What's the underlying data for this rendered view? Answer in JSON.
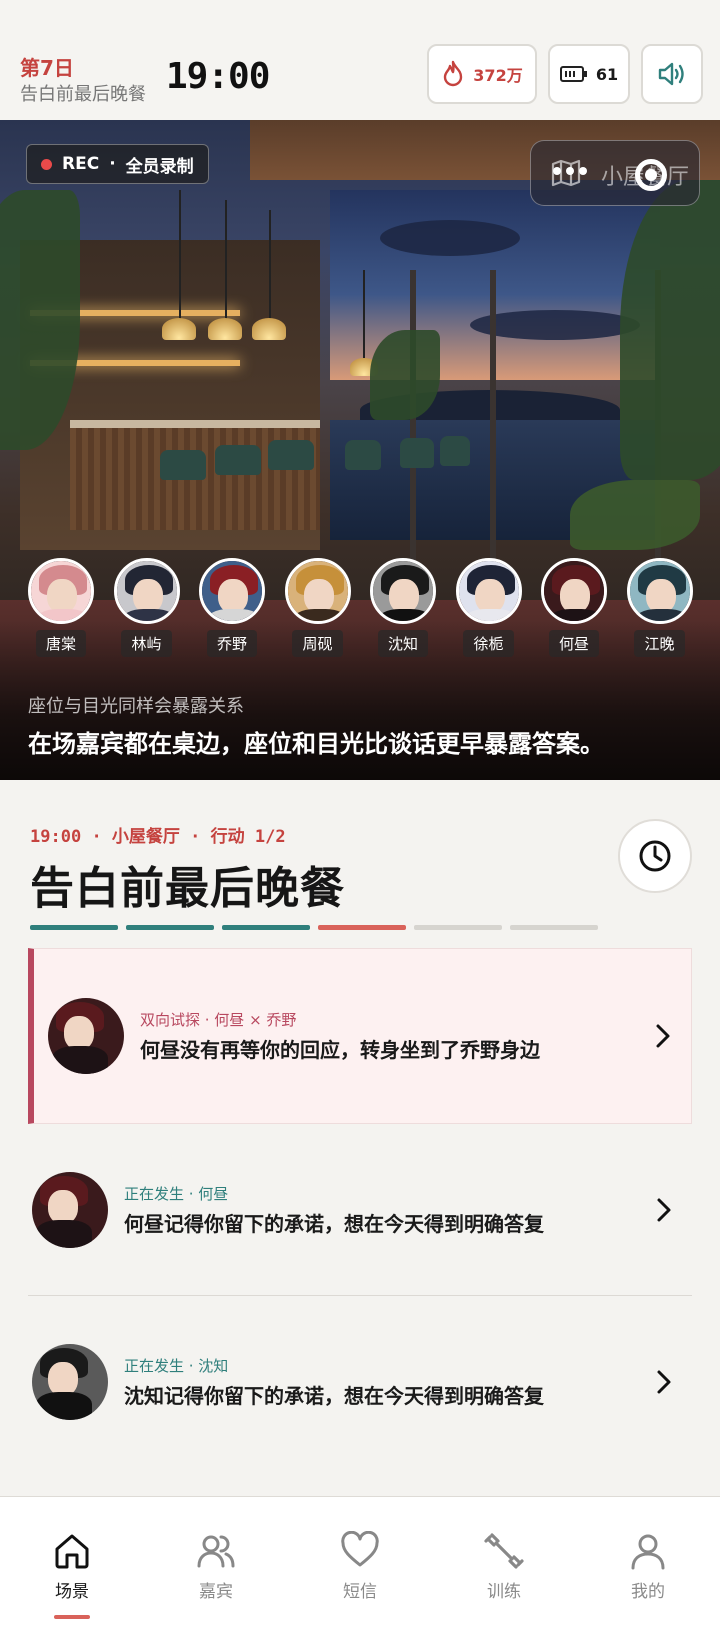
{
  "header": {
    "day": "第7日",
    "scene_name": "告白前最后晚餐",
    "time": "19:00",
    "heat": "372万",
    "battery": "61",
    "heat_icon": "flame-icon",
    "battery_icon": "battery-icon",
    "sound_icon": "speaker-icon"
  },
  "hero": {
    "rec_label": "REC",
    "rec_separator": "·",
    "rec_mode": "全员录制",
    "location_button": "小屋餐厅",
    "guests": [
      {
        "name": "唐棠",
        "hair": "#d48a8e",
        "body": "#f2c6c9",
        "bg": "#f6d6d6"
      },
      {
        "name": "林屿",
        "hair": "#222634",
        "body": "#2e3346",
        "bg": "#c8c8cc"
      },
      {
        "name": "乔野",
        "hair": "#8a1f24",
        "body": "#d6d6d6",
        "bg": "#3f5f8a"
      },
      {
        "name": "周砚",
        "hair": "#c6903a",
        "body": "#3a2a1e",
        "bg": "#d9b27a"
      },
      {
        "name": "沈知",
        "hair": "#1a1a1a",
        "body": "#111111",
        "bg": "#9a9a9a"
      },
      {
        "name": "徐栀",
        "hair": "#1e2436",
        "body": "#e8e8ee",
        "bg": "#dfe2ee"
      },
      {
        "name": "何昼",
        "hair": "#5a1a1e",
        "body": "#1d1215",
        "bg": "#3a1a1c"
      },
      {
        "name": "江晚",
        "hair": "#203a44",
        "body": "#24303c",
        "bg": "#8fb7c2"
      }
    ],
    "hint": "座位与目光同样会暴露关系",
    "caption": "在场嘉宾都在桌边，座位和目光比谈话更早暴露答案。"
  },
  "scene": {
    "time": "19:00",
    "location": "小屋餐厅",
    "action": "行动 1/2",
    "title": "告白前最后晚餐",
    "progress": [
      "done",
      "done",
      "done",
      "active",
      "todo",
      "todo"
    ],
    "history_icon": "clock-icon"
  },
  "events": [
    {
      "tag": "双向试探 · 何昼 × 乔野",
      "body": "何昼没有再等你的回应，转身坐到了乔野身边",
      "hair": "#5a1a1e",
      "bodycol": "#1d1215",
      "bg": "#3a1a1c"
    },
    {
      "tag": "正在发生 · 何昼",
      "body": "何昼记得你留下的承诺，想在今天得到明确答复",
      "hair": "#5a1a1e",
      "bodycol": "#1d1215",
      "bg": "#3a1a1c"
    },
    {
      "tag": "正在发生 · 沈知",
      "body": "沈知记得你留下的承诺，想在今天得到明确答复",
      "hair": "#1a1a1a",
      "bodycol": "#111111",
      "bg": "#5a5a5a"
    }
  ],
  "nav": [
    {
      "label": "场景",
      "icon": "home-icon",
      "active": true
    },
    {
      "label": "嘉宾",
      "icon": "users-icon",
      "active": false
    },
    {
      "label": "短信",
      "icon": "heart-icon",
      "active": false
    },
    {
      "label": "训练",
      "icon": "dumbbell-icon",
      "active": false
    },
    {
      "label": "我的",
      "icon": "user-icon",
      "active": false
    }
  ],
  "colors": {
    "accent_red": "#c5433f",
    "teal": "#2f7f7c",
    "card_border": "#b8485f"
  }
}
